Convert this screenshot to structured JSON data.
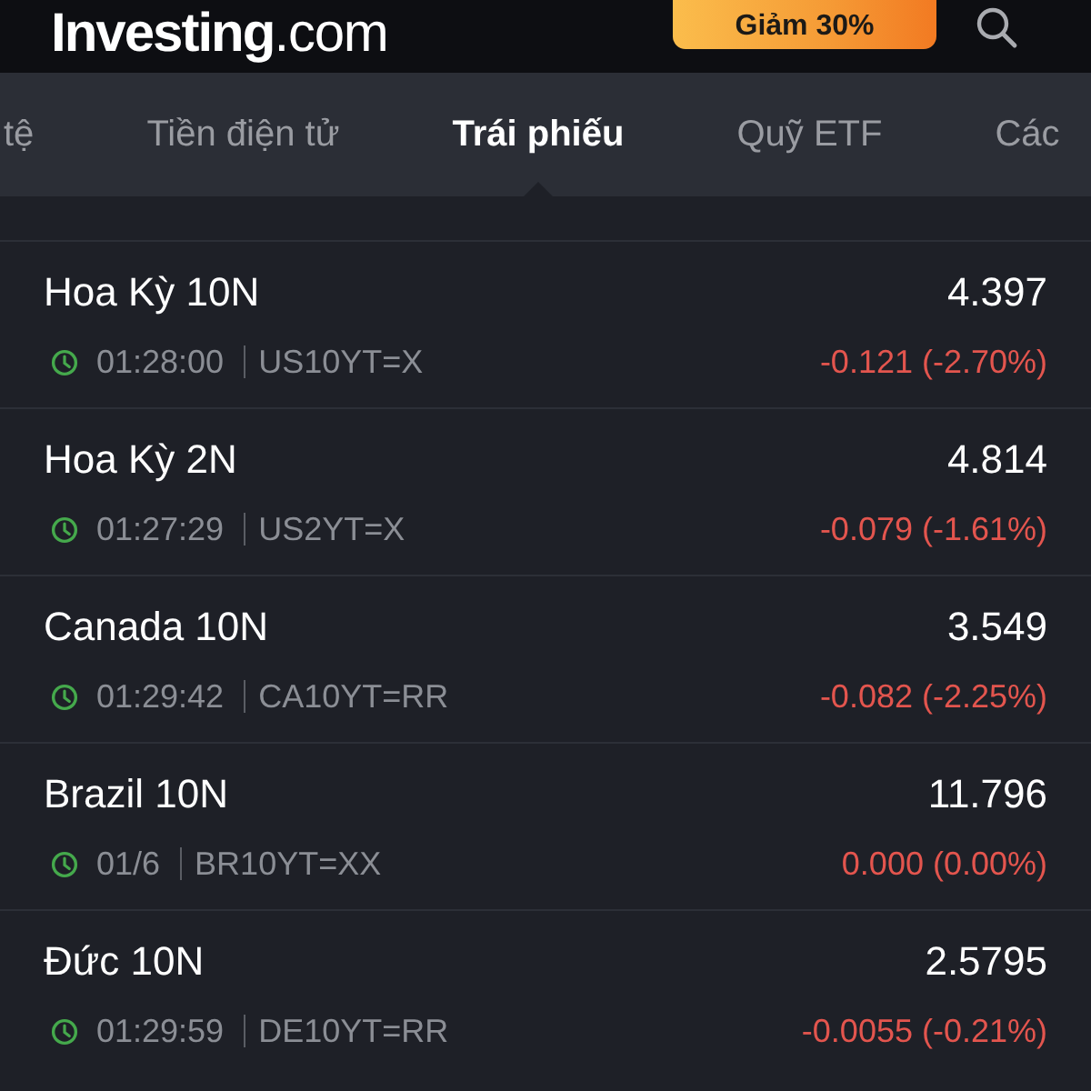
{
  "header": {
    "logo": "**Investing**.com",
    "promo_button": "Giảm 30%"
  },
  "tabs": [
    {
      "label": "tệ",
      "selected": false
    },
    {
      "label": "Tiền điện tử",
      "selected": false
    },
    {
      "label": "Trái phiếu",
      "selected": true
    },
    {
      "label": "Quỹ ETF",
      "selected": false
    },
    {
      "label": "Các",
      "selected": false
    }
  ],
  "bonds": [
    {
      "name": "Hoa Kỳ 10N",
      "time": "01:28:00",
      "symbol": "US10YT=X",
      "price": "4.397",
      "change": "-0.121 (-2.70%)"
    },
    {
      "name": "Hoa Kỳ 2N",
      "time": "01:27:29",
      "symbol": "US2YT=X",
      "price": "4.814",
      "change": "-0.079 (-1.61%)"
    },
    {
      "name": "Canada 10N",
      "time": "01:29:42",
      "symbol": "CA10YT=RR",
      "price": "3.549",
      "change": "-0.082 (-2.25%)"
    },
    {
      "name": "Brazil 10N",
      "time": "01/6",
      "symbol": "BR10YT=XX",
      "price": "11.796",
      "change": "0.000 (0.00%)"
    },
    {
      "name": "Đức 10N",
      "time": "01:29:59",
      "symbol": "DE10YT=RR",
      "price": "2.5795",
      "change": "-0.0055 (-0.21%)"
    }
  ]
}
